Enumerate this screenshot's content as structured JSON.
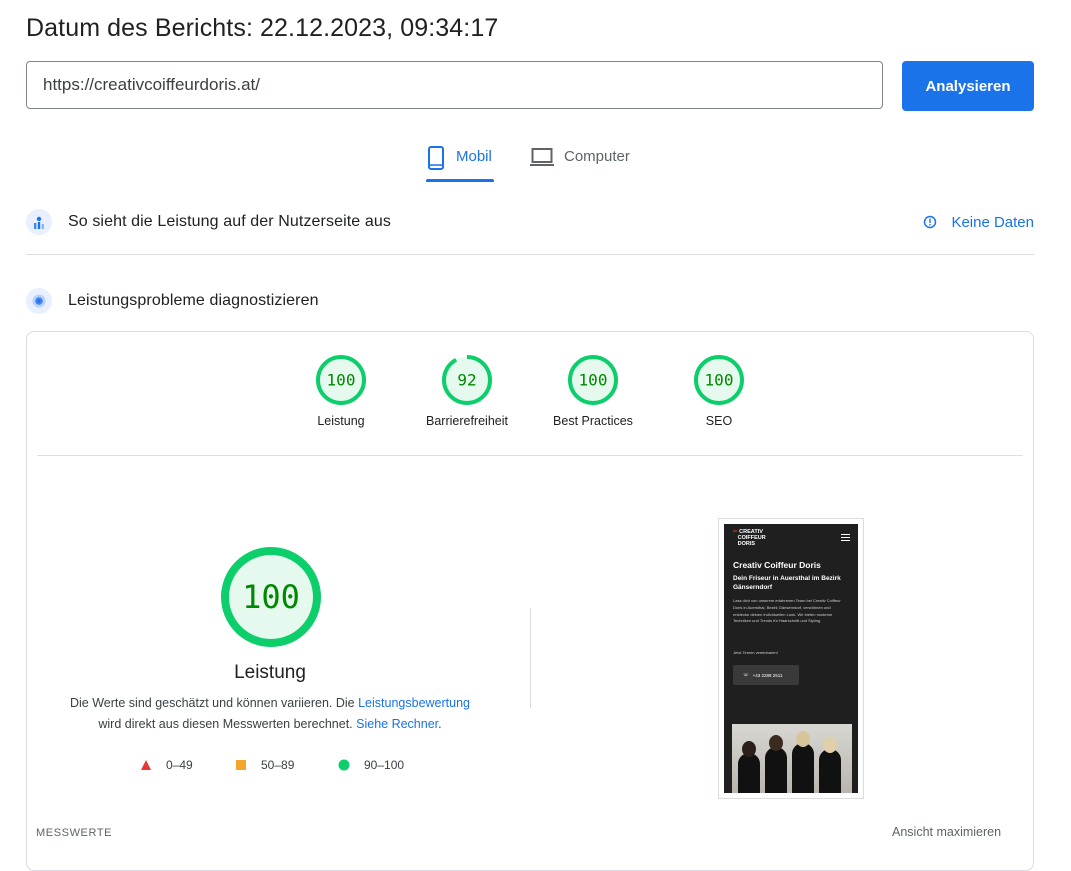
{
  "report": {
    "date_label": "Datum des Berichts: 22.12.2023, 09:34:17"
  },
  "search": {
    "url_value": "https://creativcoiffeurdoris.at/",
    "analyze_label": "Analysieren"
  },
  "tabs": [
    {
      "label": "Mobil",
      "active": true,
      "icon": "smartphone-icon"
    },
    {
      "label": "Computer",
      "active": false,
      "icon": "laptop-icon"
    }
  ],
  "field_section": {
    "title": "So sieht die Leistung auf der Nutzerseite aus",
    "no_data_label": "Keine Daten",
    "icon": "field-data-icon"
  },
  "lab_section": {
    "title": "Leistungsprobleme diagnostizieren",
    "icon": "lab-data-icon"
  },
  "scores": [
    {
      "label": "Leistung",
      "value": 100
    },
    {
      "label": "Barrierefreiheit",
      "value": 92
    },
    {
      "label": "Best Practices",
      "value": 100
    },
    {
      "label": "SEO",
      "value": 100
    }
  ],
  "performance": {
    "value": 100,
    "label": "Leistung",
    "desc_part1": "Die Werte sind geschätzt und können variieren. Die ",
    "desc_link1": "Leistungsbewertung",
    "desc_part2": " wird direkt aus diesen Messwerten berechnet. ",
    "desc_link2": "Siehe Rechner",
    "desc_part3": "."
  },
  "legend": [
    {
      "range": "0–49",
      "shape": "triangle",
      "color": "#e53935"
    },
    {
      "range": "50–89",
      "shape": "square",
      "color": "#f4a62a"
    },
    {
      "range": "90–100",
      "shape": "circle",
      "color": "#0cce6b"
    }
  ],
  "screenshot": {
    "logo_line1": "CREATIV",
    "logo_line2": "COIFFEUR",
    "logo_line3": "DORIS",
    "title": "Creativ Coiffeur Doris",
    "subtitle": "Dein Friseur in Auersthal im Bezirk Gänserndorf",
    "body": "Lass dich von unserem erfahrenen Team bei Creativ Coiffeur Doris in Auersthal, Bezirk Gänserndorf, verwöhnen und entdecke deinen individuellen Look. Wir bieten moderne Techniken und Trends für Haarschnitt und Styling.",
    "cta": "Jetzt Termin vereinbaren!",
    "phone": "+43 2288 2511"
  },
  "footer": {
    "metrics_label": "MESSWERTE",
    "expand_label": "Ansicht maximieren"
  },
  "colors": {
    "accent": "#1a73e8",
    "pass": "#0cce6b",
    "pass_text": "#008800",
    "pass_bg": "#e6f9ee"
  }
}
